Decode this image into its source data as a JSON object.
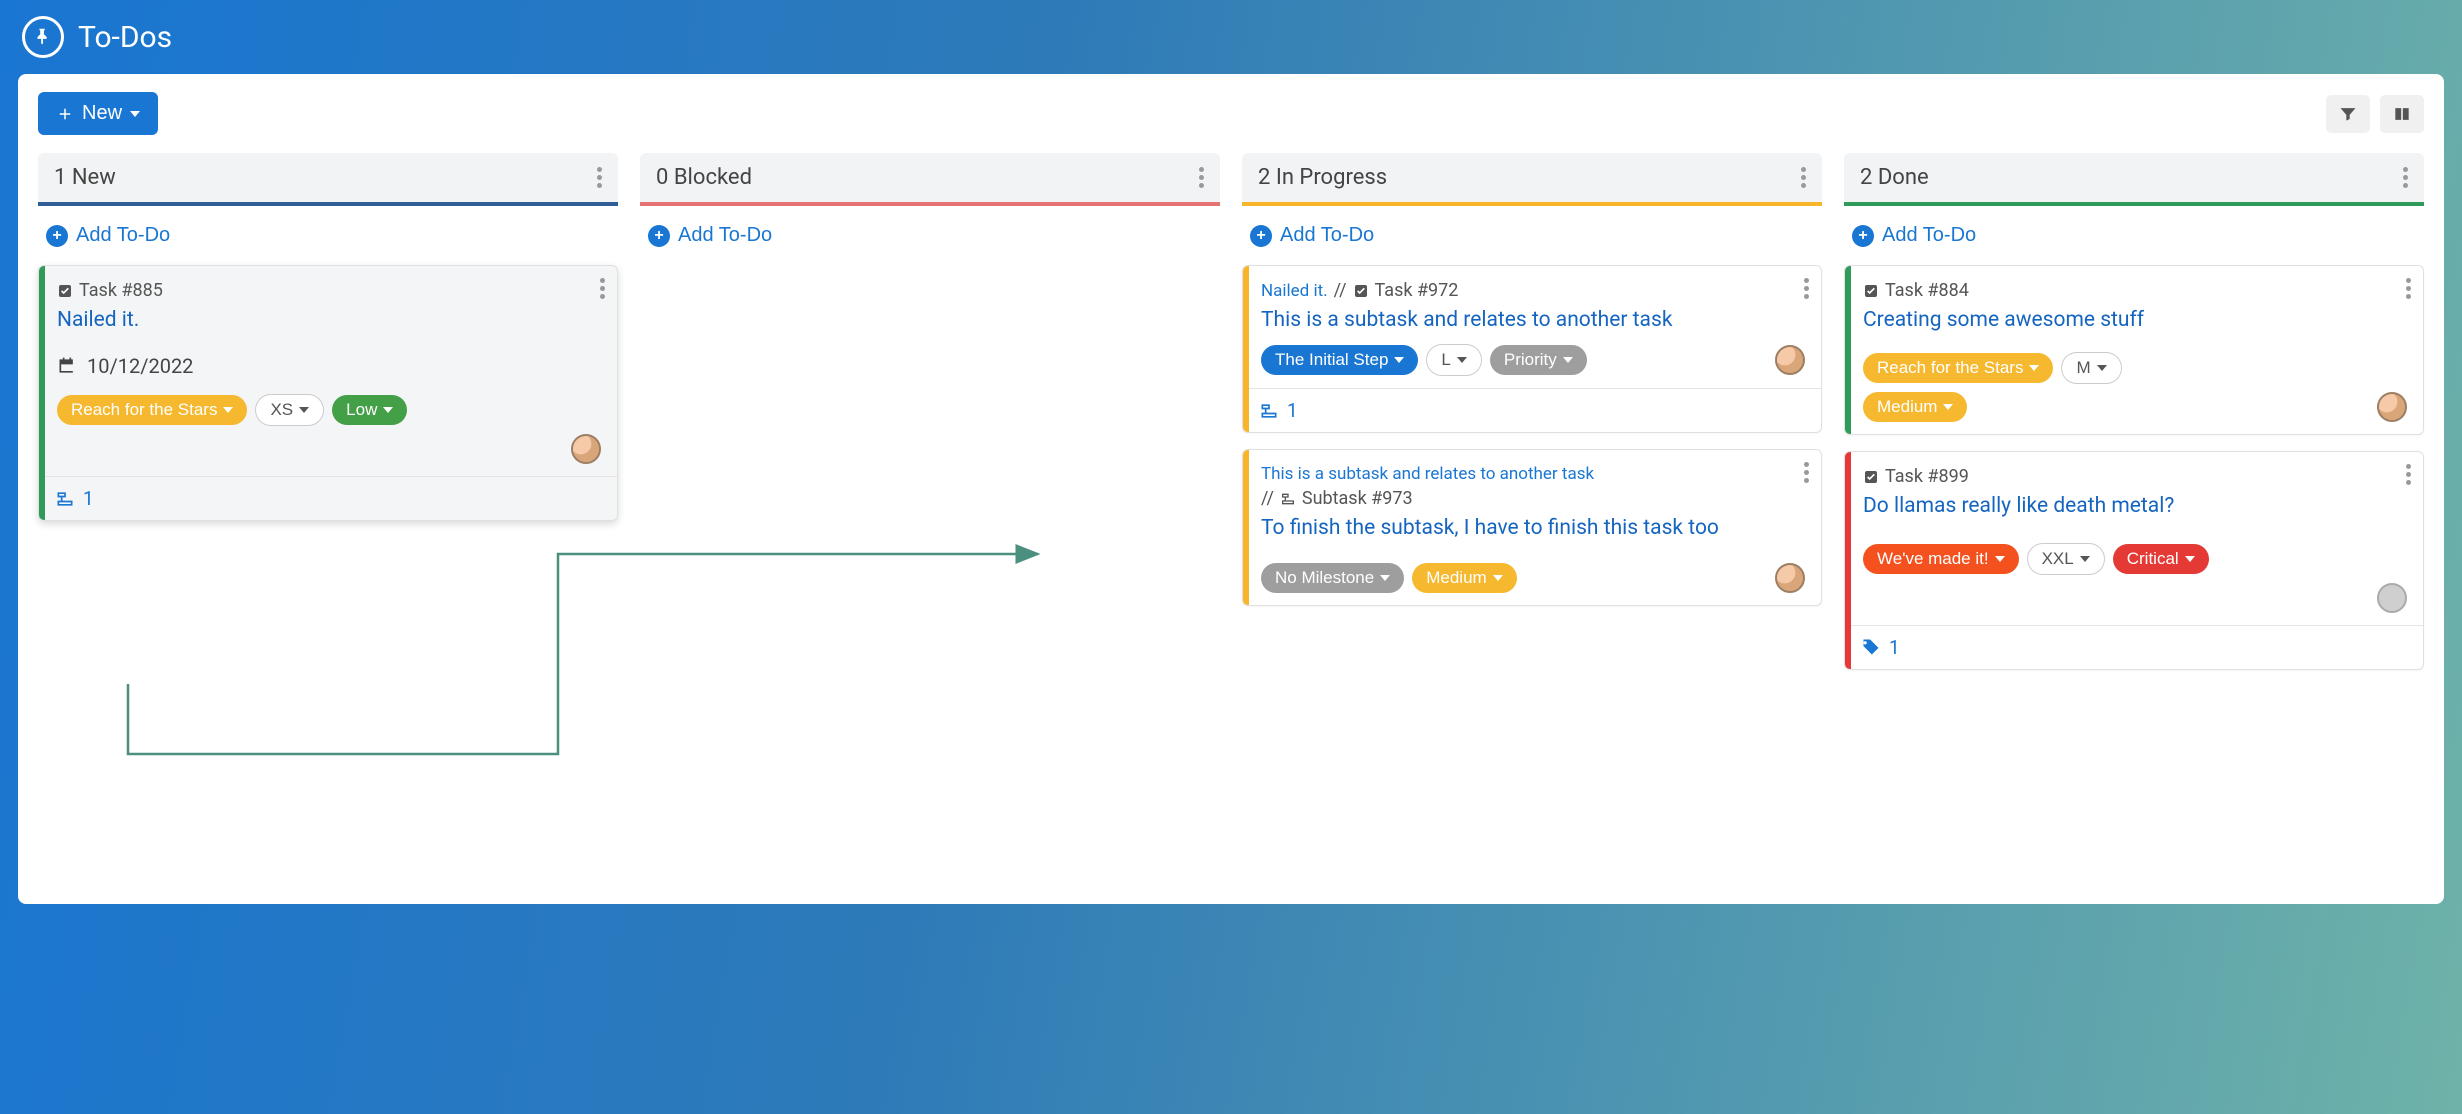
{
  "app_title": "To-Dos",
  "new_button_label": "New",
  "columns": [
    {
      "key": "new",
      "count": 1,
      "label": "New"
    },
    {
      "key": "blocked",
      "count": 0,
      "label": "Blocked"
    },
    {
      "key": "inprogress",
      "count": 2,
      "label": "In Progress"
    },
    {
      "key": "done",
      "count": 2,
      "label": "Done"
    }
  ],
  "add_todo_label": "Add To-Do",
  "cards": {
    "new": [
      {
        "ref": "Task #885",
        "title": "Nailed it.",
        "date": "10/12/2022",
        "stripe": "#2f9b5b",
        "pills": [
          {
            "label": "Reach for the Stars",
            "style": "yellow"
          },
          {
            "label": "XS",
            "style": "outline"
          },
          {
            "label": "Low",
            "style": "green"
          }
        ],
        "footer_count": "1",
        "has_avatar": true
      }
    ],
    "inprogress": [
      {
        "breadcrumb": "Nailed it.",
        "ref": "Task #972",
        "title": "This is a subtask and relates to another task",
        "stripe": "#f9b52a",
        "pills": [
          {
            "label": "The Initial Step",
            "style": "blue"
          },
          {
            "label": "L",
            "style": "outline"
          },
          {
            "label": "Priority",
            "style": "grey"
          }
        ],
        "footer_count": "1",
        "has_avatar": true,
        "avatar_inline": true
      },
      {
        "breadcrumb": "This is a subtask and relates to another task",
        "ref": "Subtask #973",
        "ref_icon": "subtask",
        "title": "To finish the subtask, I have to finish this task too",
        "stripe": "#f9b52a",
        "pills": [
          {
            "label": "No Milestone",
            "style": "grey"
          },
          {
            "label": "Medium",
            "style": "yellow"
          }
        ],
        "has_avatar": true,
        "avatar_inline": true
      }
    ],
    "done": [
      {
        "ref": "Task #884",
        "title": "Creating some awesome stuff",
        "stripe": "#2f9b5b",
        "pills": [
          {
            "label": "Reach for the Stars",
            "style": "yellow"
          },
          {
            "label": "M",
            "style": "outline"
          }
        ],
        "pills2": [
          {
            "label": "Medium",
            "style": "yellow"
          }
        ],
        "has_avatar": true,
        "avatar_inline": true
      },
      {
        "ref": "Task #899",
        "title": "Do llamas really like death metal?",
        "stripe": "#e53935",
        "pills": [
          {
            "label": "We've made it!",
            "style": "orange"
          },
          {
            "label": "XXL",
            "style": "outline"
          },
          {
            "label": "Critical",
            "style": "red"
          }
        ],
        "footer_count": "1",
        "footer_icon": "tag",
        "has_avatar": true,
        "avatar_grey": true
      }
    ]
  },
  "breadcrumb_sep": "//"
}
